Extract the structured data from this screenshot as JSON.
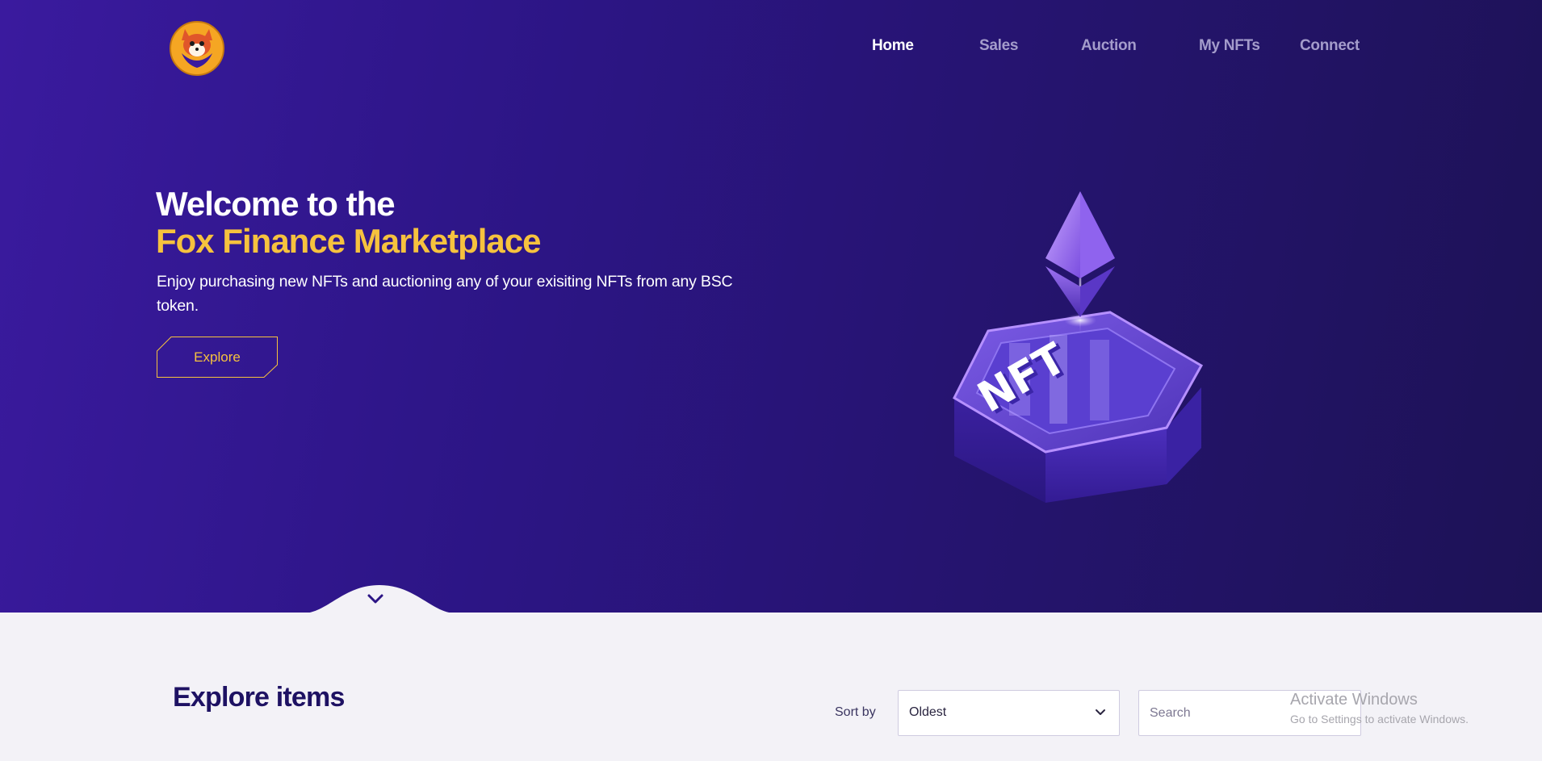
{
  "nav": {
    "items": [
      {
        "label": "Home",
        "active": true
      },
      {
        "label": "Sales",
        "active": false
      },
      {
        "label": "Auction",
        "active": false
      },
      {
        "label": "My NFTs",
        "active": false
      },
      {
        "label": "Connect",
        "active": false
      }
    ]
  },
  "hero": {
    "title_line1": "Welcome to the",
    "title_line2": "Fox Finance Marketplace",
    "subtitle": "Enjoy purchasing new NFTs and auctioning any of your exisiting NFTs from any BSC token.",
    "explore_label": "Explore",
    "art_text": "NFT"
  },
  "explore": {
    "title": "Explore items",
    "sort_label": "Sort by",
    "sort_value": "Oldest",
    "search_placeholder": "Search"
  },
  "overlay": {
    "activate_title": "Activate Windows",
    "activate_sub": "Go to Settings to activate Windows."
  },
  "icons": {
    "logo": "fox-logo-icon",
    "scroll": "chevron-down-icon",
    "sort_chevron": "chevron-down-icon"
  },
  "colors": {
    "hero_bg": "#2c1585",
    "accent_yellow": "#f6c23e",
    "nav_inactive": "#a49ccb",
    "section_bg": "#f3f2f7",
    "title_dark": "#1e1263"
  }
}
